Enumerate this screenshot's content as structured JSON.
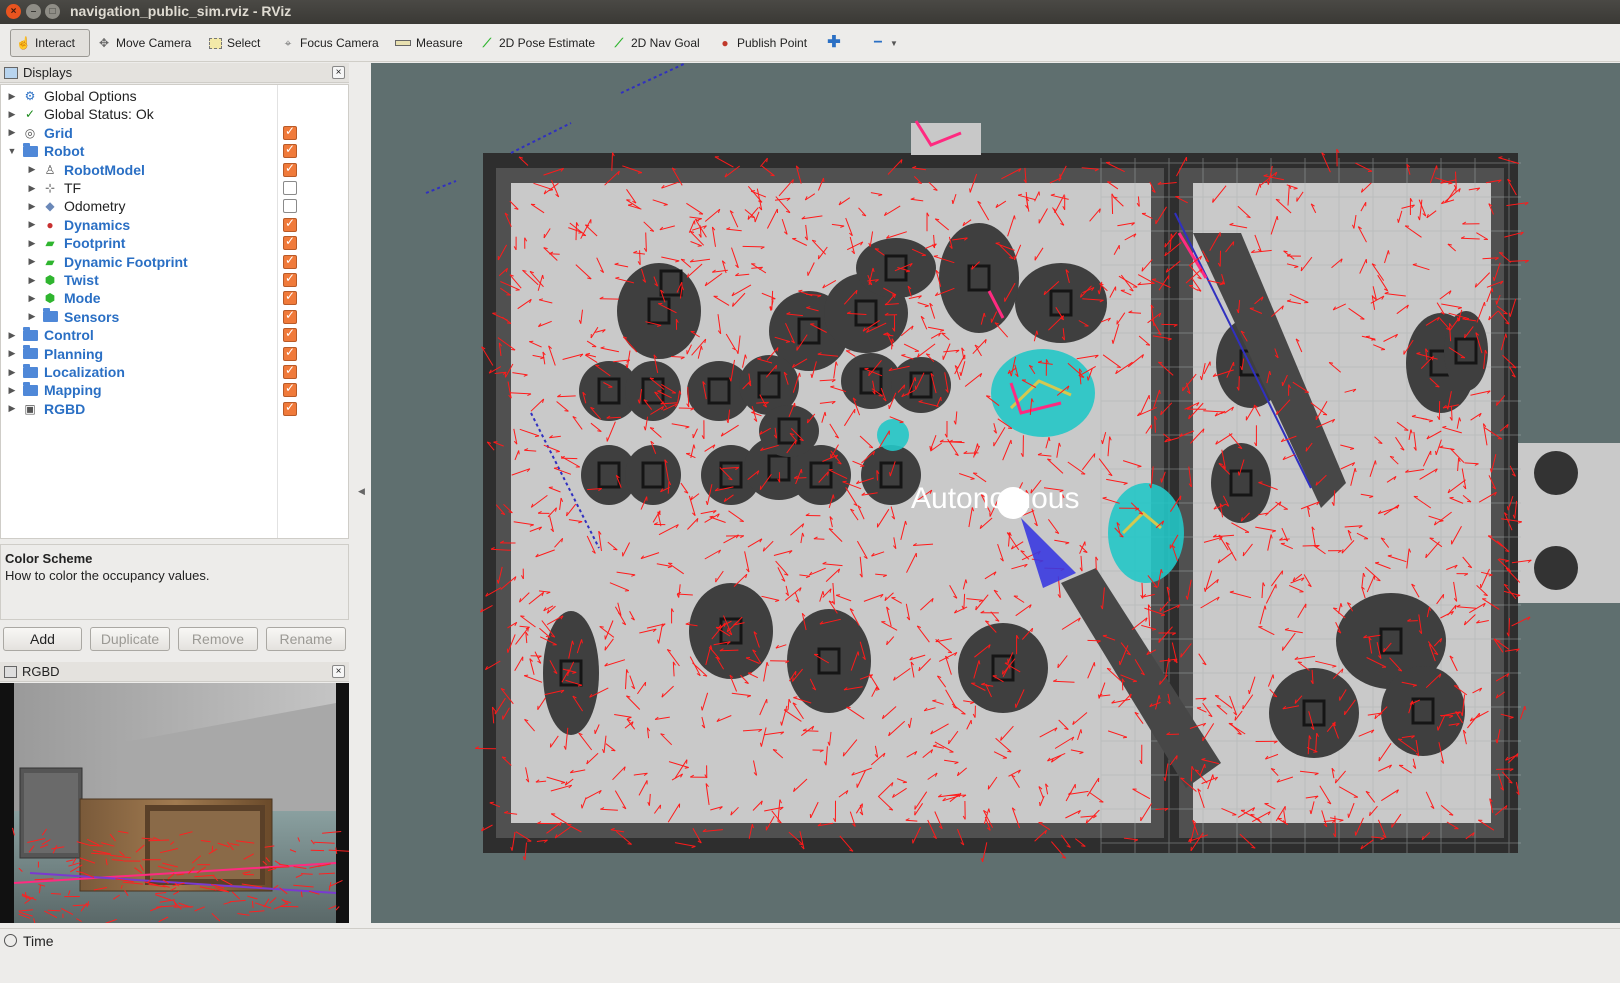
{
  "window": {
    "title": "navigation_public_sim.rviz - RViz",
    "buttons": {
      "close": "×",
      "minimize": "–",
      "maximize": "□"
    }
  },
  "toolbar": {
    "tools": [
      {
        "label": "Interact",
        "icon": "hand-cursor-icon",
        "active": true
      },
      {
        "label": "Move Camera",
        "icon": "move-camera-icon"
      },
      {
        "label": "Select",
        "icon": "select-rect-icon"
      },
      {
        "label": "Focus Camera",
        "icon": "focus-target-icon"
      },
      {
        "label": "Measure",
        "icon": "ruler-icon"
      },
      {
        "label": "2D Pose Estimate",
        "icon": "green-arrow-icon"
      },
      {
        "label": "2D Nav Goal",
        "icon": "green-arrow-icon"
      },
      {
        "label": "Publish Point",
        "icon": "map-pin-icon"
      },
      {
        "label": "",
        "icon": "add-tool-icon"
      },
      {
        "label": "",
        "icon": "remove-tool-icon"
      }
    ]
  },
  "displays": {
    "title": "Displays",
    "items": [
      {
        "label": "Global Options",
        "indent": 0,
        "expand": "▶",
        "icon": "gear-icon",
        "checked": null,
        "blue": false
      },
      {
        "label": "Global Status: Ok",
        "indent": 0,
        "expand": "▶",
        "icon": "check-icon",
        "checked": null,
        "blue": false
      },
      {
        "label": "Grid",
        "indent": 0,
        "expand": "▶",
        "icon": "grid-icon",
        "checked": true,
        "blue": true
      },
      {
        "label": "Robot",
        "indent": 0,
        "expand": "▼",
        "icon": "folder-icon",
        "checked": true,
        "blue": true
      },
      {
        "label": "RobotModel",
        "indent": 1,
        "expand": "▶",
        "icon": "robot-model-icon",
        "checked": true,
        "blue": true
      },
      {
        "label": "TF",
        "indent": 1,
        "expand": "▶",
        "icon": "tf-axes-icon",
        "checked": false,
        "blue": false
      },
      {
        "label": "Odometry",
        "indent": 1,
        "expand": "▶",
        "icon": "odometry-icon",
        "checked": false,
        "blue": false
      },
      {
        "label": "Dynamics",
        "indent": 1,
        "expand": "▶",
        "icon": "dynamics-icon",
        "checked": true,
        "blue": true
      },
      {
        "label": "Footprint",
        "indent": 1,
        "expand": "▶",
        "icon": "polygon-icon",
        "checked": true,
        "blue": true
      },
      {
        "label": "Dynamic Footprint",
        "indent": 1,
        "expand": "▶",
        "icon": "polygon-icon",
        "checked": true,
        "blue": true
      },
      {
        "label": "Twist",
        "indent": 1,
        "expand": "▶",
        "icon": "marker-icon",
        "checked": true,
        "blue": true
      },
      {
        "label": "Mode",
        "indent": 1,
        "expand": "▶",
        "icon": "marker-icon",
        "checked": true,
        "blue": true
      },
      {
        "label": "Sensors",
        "indent": 1,
        "expand": "▶",
        "icon": "folder-icon",
        "checked": true,
        "blue": true
      },
      {
        "label": "Control",
        "indent": 0,
        "expand": "▶",
        "icon": "folder-icon",
        "checked": true,
        "blue": true
      },
      {
        "label": "Planning",
        "indent": 0,
        "expand": "▶",
        "icon": "folder-icon",
        "checked": true,
        "blue": true
      },
      {
        "label": "Localization",
        "indent": 0,
        "expand": "▶",
        "icon": "folder-icon",
        "checked": true,
        "blue": true
      },
      {
        "label": "Mapping",
        "indent": 0,
        "expand": "▶",
        "icon": "folder-icon",
        "checked": true,
        "blue": true
      },
      {
        "label": "RGBD",
        "indent": 0,
        "expand": "▶",
        "icon": "image-icon",
        "checked": true,
        "blue": true
      }
    ]
  },
  "description": {
    "title": "Color Scheme",
    "text": "How to color the occupancy values."
  },
  "buttons": {
    "add": "Add",
    "duplicate": "Duplicate",
    "remove": "Remove",
    "rename": "Rename"
  },
  "rgbd_panel": {
    "title": "RGBD"
  },
  "viewport": {
    "overlay_text": "Autonomous",
    "colors": {
      "background": "#5f6f6f",
      "free_space": "#c8c8c8",
      "obstacle": "#3a3a3a",
      "inflation": "#5a5a5a",
      "particles": "#ff1a1a",
      "costmap_highlight": "#22c8c8",
      "path": "#3030c0",
      "footprint": "#ff2a80"
    }
  },
  "time_panel": {
    "label": "Time"
  }
}
